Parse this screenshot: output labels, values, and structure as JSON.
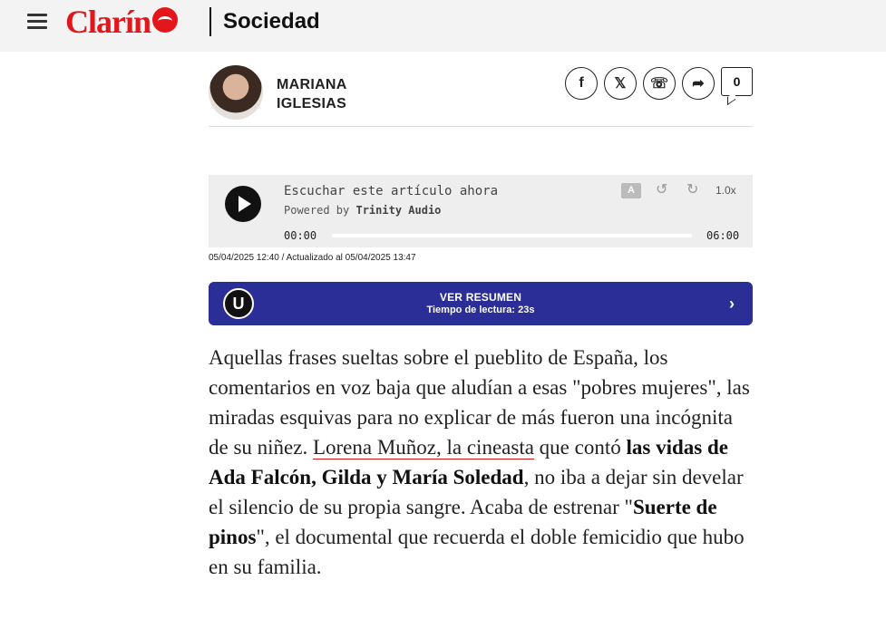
{
  "header": {
    "logo_text": "Clarín",
    "section": "Sociedad",
    "brand_color": "#e3161c"
  },
  "author": {
    "first": "MARIANA",
    "last": "IGLESIAS"
  },
  "share": {
    "facebook": "f",
    "x": "𝕏",
    "whatsapp": "☏",
    "share": "➦",
    "comments_count": "0"
  },
  "player": {
    "title": "Escuchar este artículo ahora",
    "powered_by": "Powered by",
    "provider": "Trinity Audio",
    "translate": "A",
    "rewind": "↺",
    "forward": "↻",
    "speed": "1.0x",
    "current_time": "00:00",
    "total_time": "06:00",
    "progress": 0
  },
  "dateline": "05/04/2025 12:40 / Actualizado al 05/04/2025 13:47",
  "summary": {
    "logo": "U",
    "title": "VER RESUMEN",
    "subtitle": "Tiempo de lectura: 23s",
    "chevron": "›",
    "color": "#2a2e96"
  },
  "article": {
    "t1": "Aquellas frases sueltas sobre el pueblito de España, los comentarios en voz baja que aludían a esas \"pobres mujeres\", las miradas esquivas para no explicar de más fueron una incógnita de su niñez. ",
    "link": "Lorena Muñoz, la cineasta",
    "t2": " que contó ",
    "bold1": "las vidas de Ada Falcón, Gilda y María Soledad",
    "t3": ", no iba a dejar sin develar el silencio de su propia sangre. Acaba de estrenar \"",
    "bold2": "Suerte de pinos",
    "t4": "\", el documental que recuerda el doble femicidio que hubo en su familia."
  }
}
